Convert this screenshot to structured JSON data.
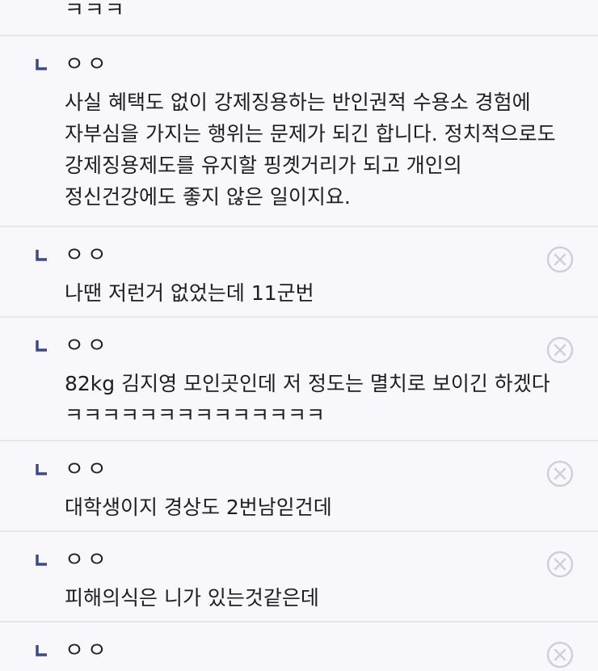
{
  "comments": [
    {
      "author": "",
      "text": "ㅋㅋㅋ"
    },
    {
      "author": "ㅇㅇ",
      "text": "사실 혜택도 없이 강제징용하는 반인권적 수용소 경험에 자부심을 가지는 행위는 문제가 되긴 합니다. 정치적으로도 강제징용제도를 유지할 핑곗거리가 되고 개인의 정신건강에도 좋지 않은 일이지요."
    },
    {
      "author": "ㅇㅇ",
      "text": "나땐 저런거 없었는데 11군번"
    },
    {
      "author": "ㅇㅇ",
      "text": "82kg 김지영 모인곳인데 저 정도는 멸치로 보이긴 하겠다 ㅋㅋㅋㅋㅋㅋㅋㅋㅋㅋㅋㅋㅋㅋ"
    },
    {
      "author": "ㅇㅇ",
      "text": "대학생이지 경상도 2번남읻건데"
    },
    {
      "author": "ㅇㅇ",
      "text": "피해의식은 니가 있는것같은데"
    },
    {
      "author": "ㅇㅇ",
      "text": ""
    }
  ],
  "colors": {
    "background": "#f8f8fc",
    "divider": "#e6e6ec",
    "reply_mark": "#3b4a8a",
    "delete_icon": "#cfcfd6"
  },
  "icons": {
    "reply_mark": "reply-indent-icon",
    "delete": "close-circle-icon"
  }
}
